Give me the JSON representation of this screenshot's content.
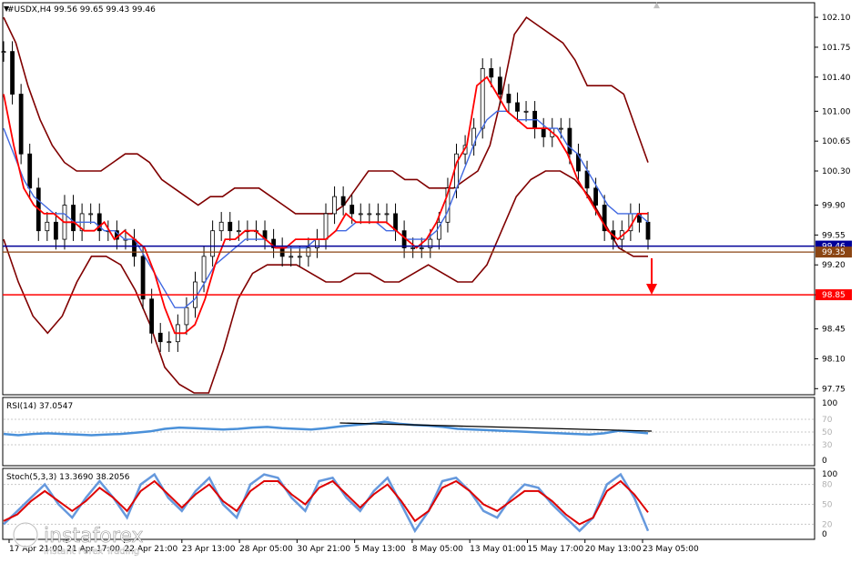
{
  "header": {
    "title": "#USDX,H4",
    "ohlc": "99.56 99.65 99.43 99.46"
  },
  "price_axis": {
    "ticks": [
      "102.10",
      "101.75",
      "101.40",
      "101.00",
      "100.65",
      "100.30",
      "99.90",
      "99.55",
      "99.20",
      "98.85",
      "98.45",
      "98.10",
      "97.75"
    ],
    "ylim": [
      97.7,
      102.25
    ]
  },
  "levels": {
    "blue_label": "99.46",
    "brown_label": "99.35",
    "red_label": "98.85",
    "blue_value": 99.42,
    "brown_value": 99.35,
    "red_value": 98.85,
    "blue_color": "#000099",
    "brown_color": "#8b4513",
    "red_color": "#ff0000"
  },
  "rsi_panel": {
    "label": "RSI(14) 37.0547",
    "ticks": [
      "100",
      "70",
      "50",
      "30",
      "0"
    ]
  },
  "stoch_panel": {
    "label": "Stoch(5,3,3) 13.3690 38.2056",
    "ticks": [
      "100",
      "80",
      "50",
      "20",
      "0"
    ]
  },
  "time_axis": {
    "ticks": [
      "17 Apr 21:00",
      "21 Apr 17:00",
      "22 Apr 21:00",
      "23 Apr 13:00",
      "28 Apr 05:00",
      "30 Apr 21:00",
      "5 May 13:00",
      "8 May 05:00",
      "13 May 01:00",
      "15 May 17:00",
      "20 May 13:00",
      "23 May 05:00"
    ]
  },
  "watermark": {
    "brand": "instaforex",
    "tagline": "Instant Forex Trading"
  },
  "colors": {
    "candles": "#000000",
    "bollinger": "#800000",
    "ma_fast": "#ff0000",
    "ma_slow": "#4169e1",
    "rsi_line": "#4a90d9",
    "stoch_main": "#6699dd",
    "stoch_signal": "#dd0000",
    "trendline": "#000000",
    "arrow": "#ff0000"
  },
  "chart_data": {
    "type": "candlestick",
    "timeframe": "H4",
    "symbol": "#USDX",
    "close": [
      101.7,
      101.2,
      100.5,
      100.1,
      99.6,
      99.7,
      99.5,
      99.9,
      99.6,
      99.8,
      99.8,
      99.6,
      99.6,
      99.5,
      99.5,
      99.3,
      98.8,
      98.4,
      98.3,
      98.3,
      98.5,
      98.7,
      99.0,
      99.3,
      99.6,
      99.7,
      99.6,
      99.6,
      99.6,
      99.6,
      99.5,
      99.4,
      99.3,
      99.3,
      99.3,
      99.4,
      99.5,
      99.8,
      100.0,
      99.9,
      99.8,
      99.8,
      99.8,
      99.8,
      99.8,
      99.6,
      99.4,
      99.4,
      99.4,
      99.5,
      99.7,
      100.1,
      100.5,
      100.6,
      100.8,
      101.5,
      101.4,
      101.2,
      101.1,
      101.0,
      101.0,
      100.8,
      100.7,
      100.8,
      100.8,
      100.5,
      100.3,
      100.1,
      99.9,
      99.6,
      99.5,
      99.6,
      99.8,
      99.7,
      99.5
    ],
    "ma_fast": [
      101.2,
      100.6,
      100.1,
      99.9,
      99.8,
      99.8,
      99.7,
      99.7,
      99.6,
      99.6,
      99.7,
      99.5,
      99.6,
      99.5,
      99.4,
      99.1,
      98.7,
      98.4,
      98.4,
      98.5,
      98.8,
      99.2,
      99.5,
      99.5,
      99.6,
      99.6,
      99.5,
      99.4,
      99.4,
      99.5,
      99.5,
      99.5,
      99.5,
      99.6,
      99.8,
      99.7,
      99.7,
      99.7,
      99.7,
      99.6,
      99.5,
      99.4,
      99.5,
      99.7,
      100.0,
      100.4,
      100.6,
      101.3,
      101.4,
      101.2,
      101.0,
      100.9,
      100.8,
      100.8,
      100.8,
      100.7,
      100.5,
      100.2,
      100.0,
      99.8,
      99.6,
      99.5,
      99.6,
      99.8,
      99.8
    ],
    "ma_slow": [
      100.8,
      100.5,
      100.2,
      100.0,
      99.9,
      99.8,
      99.8,
      99.7,
      99.7,
      99.7,
      99.6,
      99.6,
      99.5,
      99.5,
      99.3,
      99.1,
      98.9,
      98.7,
      98.7,
      98.8,
      99.0,
      99.2,
      99.3,
      99.4,
      99.5,
      99.5,
      99.5,
      99.4,
      99.4,
      99.4,
      99.4,
      99.5,
      99.5,
      99.6,
      99.6,
      99.7,
      99.7,
      99.7,
      99.6,
      99.6,
      99.5,
      99.5,
      99.5,
      99.6,
      99.8,
      100.1,
      100.4,
      100.7,
      100.9,
      101.0,
      101.0,
      100.9,
      100.9,
      100.9,
      100.8,
      100.8,
      100.6,
      100.5,
      100.3,
      100.1,
      99.9,
      99.8,
      99.8,
      99.8,
      99.7
    ],
    "bb_upper": [
      102.1,
      101.8,
      101.3,
      100.9,
      100.6,
      100.4,
      100.3,
      100.3,
      100.3,
      100.4,
      100.5,
      100.5,
      100.4,
      100.2,
      100.1,
      100.0,
      99.9,
      100.0,
      100.0,
      100.1,
      100.1,
      100.1,
      100.0,
      99.9,
      99.8,
      99.8,
      99.8,
      99.8,
      99.9,
      100.1,
      100.3,
      100.3,
      100.3,
      100.2,
      100.2,
      100.1,
      100.1,
      100.1,
      100.2,
      100.3,
      100.6,
      101.2,
      101.9,
      102.1,
      102.0,
      101.9,
      101.8,
      101.6,
      101.3,
      101.3,
      101.3,
      101.2,
      100.8,
      100.4
    ],
    "bb_lower": [
      99.5,
      99.0,
      98.6,
      98.4,
      98.6,
      99.0,
      99.3,
      99.3,
      99.2,
      98.9,
      98.5,
      98.0,
      97.8,
      97.7,
      97.7,
      98.2,
      98.8,
      99.1,
      99.2,
      99.2,
      99.2,
      99.1,
      99.0,
      99.0,
      99.1,
      99.1,
      99.0,
      99.0,
      99.1,
      99.2,
      99.1,
      99.0,
      99.0,
      99.2,
      99.6,
      100.0,
      100.2,
      100.3,
      100.3,
      100.2,
      100.0,
      99.7,
      99.4,
      99.3,
      99.3
    ],
    "rsi": [
      47,
      45,
      47,
      48,
      47,
      46,
      45,
      46,
      47,
      49,
      51,
      55,
      57,
      56,
      55,
      54,
      55,
      57,
      58,
      56,
      55,
      54,
      56,
      59,
      61,
      63,
      66,
      63,
      61,
      60,
      58,
      55,
      54,
      53,
      52,
      51,
      50,
      49,
      48,
      47,
      46,
      48,
      52,
      50,
      48
    ],
    "rsi_trendline": [
      [
        0.55,
        70
      ],
      [
        1.0,
        60
      ]
    ],
    "stoch_main": [
      20,
      40,
      60,
      80,
      50,
      30,
      60,
      85,
      60,
      30,
      80,
      95,
      60,
      40,
      70,
      90,
      50,
      30,
      80,
      95,
      90,
      60,
      40,
      85,
      90,
      60,
      40,
      70,
      90,
      50,
      10,
      40,
      85,
      90,
      70,
      40,
      30,
      60,
      80,
      75,
      50,
      30,
      10,
      30,
      80,
      95,
      60,
      10
    ],
    "stoch_signal": [
      25,
      35,
      55,
      70,
      55,
      40,
      55,
      75,
      60,
      40,
      70,
      85,
      65,
      45,
      65,
      80,
      55,
      40,
      70,
      85,
      85,
      65,
      50,
      75,
      85,
      65,
      45,
      65,
      80,
      55,
      25,
      40,
      75,
      85,
      70,
      50,
      40,
      55,
      70,
      70,
      55,
      35,
      20,
      30,
      70,
      85,
      65,
      38
    ]
  }
}
